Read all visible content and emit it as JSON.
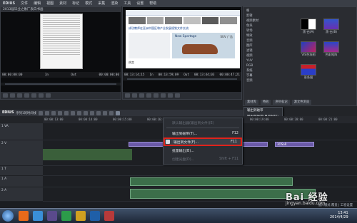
{
  "menubar": {
    "logo": "EDIUS",
    "items": [
      "文件",
      "编辑",
      "视图",
      "素材",
      "标记",
      "模式",
      "采集",
      "渲染",
      "工具",
      "设置",
      "帮助"
    ]
  },
  "player_left": {
    "title": "2013届毕业之象厂表白书画",
    "tc_in": "00:00:00:00",
    "tc_in_label": "In",
    "tc_out_label": "Out",
    "tc_dur": "00:00:00:00"
  },
  "player_right": {
    "tc_a": "00:13:14;15",
    "tc_in_label": "In",
    "tc_b": "00:13:59;09",
    "tc_out_label": "Out",
    "tc_c": "00:13:44;03",
    "tc_d": "00:00:47;21",
    "web_headline": "成功教师在亚洲中国区和产业发展规划文件交流",
    "ad_text": "New Sportage",
    "ad_sub": "SUV 广告",
    "web_caption": "热卖"
  },
  "bin": {
    "tree": [
      "根",
      "剪辑",
      "视频素材",
      "色块",
      "转场",
      "特效",
      "音频",
      "图库",
      "滤镜",
      "视频",
      "YUV",
      "RGB",
      "系统",
      "字幕",
      "音频"
    ],
    "thumbs": [
      {
        "label": "黑-白(A)"
      },
      {
        "label": "黑-白(B)"
      },
      {
        "label": "VIS色块图"
      },
      {
        "label": "色彩矩阵"
      },
      {
        "label": "彩条图"
      }
    ],
    "tabs": [
      "素材库",
      "特效",
      "序列标记",
      "源文件浏览"
    ],
    "submenu": [
      "输出到磁带",
      "输出到磁带(显示时码)"
    ]
  },
  "timeline": {
    "title": "EDIUS",
    "seq": "序列1的时间线",
    "ruler": [
      "00:00:13:00",
      "00:00:14:00",
      "00:00:15:00",
      "00:00:16:00",
      "00:00:17:00",
      "00:00:18:00",
      "00:00:19:00",
      "00:00:20:00",
      "00:00:21:00"
    ],
    "tracks": [
      {
        "name": "1 VA",
        "type": "v"
      },
      {
        "name": "2 V",
        "type": "v"
      },
      {
        "name": "1 T",
        "type": "t"
      },
      {
        "name": "1 A",
        "type": "a"
      },
      {
        "name": "2 A",
        "type": "a"
      }
    ],
    "clip_main": "3OSoR",
    "clip_right": "3OSoR",
    "status_left": "",
    "status_right": "插入模式  覆盖 | 工程设置"
  },
  "context_menu": {
    "items": [
      {
        "label": "默认输出器(输出到文件)(E)",
        "shortcut": "",
        "disabled": true
      },
      {
        "label": "输出到磁带(T)...",
        "shortcut": "F12",
        "disabled": false
      },
      {
        "label": "输出到文件(F)...",
        "shortcut": "F11",
        "disabled": false,
        "highlight": true
      },
      {
        "label": "批量输出(B)...",
        "shortcut": "",
        "disabled": false
      },
      {
        "label": "创建光盘(D)...",
        "shortcut": "Shift + F11",
        "disabled": true
      }
    ]
  },
  "taskbar": {
    "time": "13:41",
    "date": "2014/4/29"
  },
  "watermark": {
    "main": "Bai 经验",
    "url": "jingyan.baidu.com"
  },
  "colors": {
    "highlight": "#e0231b",
    "clip_video": "#6b5aa8",
    "clip_audio": "#3c6e4a"
  }
}
